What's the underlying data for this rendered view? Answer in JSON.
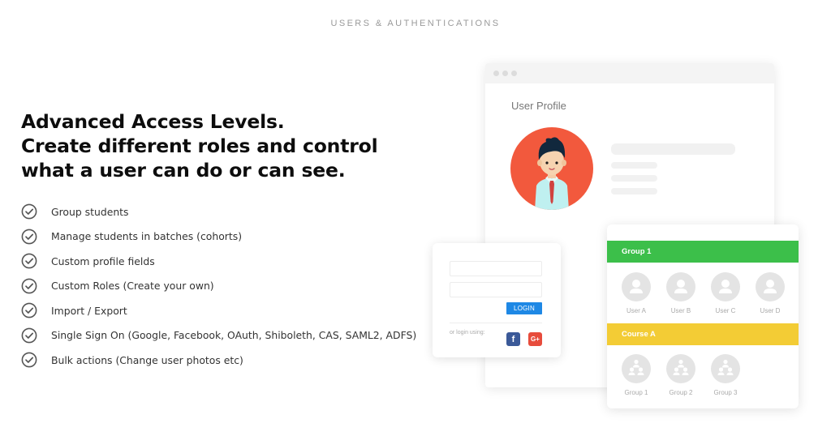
{
  "section": {
    "eyebrow": "USERS & AUTHENTICATIONS"
  },
  "headline": {
    "lines": [
      "Advanced Access Levels.",
      "Create different roles and control",
      "what a user can do or can see."
    ]
  },
  "features": [
    {
      "icon": "check-circle-icon",
      "label": "Group students"
    },
    {
      "icon": "check-circle-icon",
      "label": "Manage students in batches (cohorts)"
    },
    {
      "icon": "check-circle-icon",
      "label": "Custom profile fields"
    },
    {
      "icon": "check-circle-icon",
      "label": "Custom Roles (Create your own)"
    },
    {
      "icon": "check-circle-icon",
      "label": "Import / Export"
    },
    {
      "icon": "check-circle-icon",
      "label": "Single Sign On (Google, Facebook, OAuth, Shiboleth, CAS, SAML2, ADFS)"
    },
    {
      "icon": "check-circle-icon",
      "label": "Bulk actions (Change user photos etc)"
    }
  ],
  "profile_window": {
    "title": "User Profile",
    "avatar_icon": "man-avatar-illustration"
  },
  "login_card": {
    "username_value": "",
    "password_value": "",
    "login_label": "LOGIN",
    "alt_label": "or login using:",
    "facebook_glyph": "f",
    "google_glyph": "G+"
  },
  "groups_card": {
    "group_title": "Group 1",
    "users": [
      "User A",
      "User B",
      "User C",
      "User D"
    ],
    "course_title": "Course A",
    "groups": [
      "Group 1",
      "Group 2",
      "Group 3"
    ]
  },
  "colors": {
    "avatar_bg": "#f2593d",
    "group_band": "#3cbf4a",
    "course_band": "#f3cc35",
    "login_button": "#1e88e5",
    "facebook": "#3b5998",
    "google": "#e74c3c"
  }
}
